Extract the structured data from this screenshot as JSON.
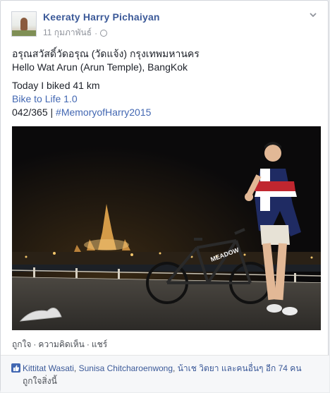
{
  "post": {
    "author": "Keeraty Harry Pichaiyan",
    "date": "11 กุมภาพันธ์",
    "meta_separator": "·",
    "body": {
      "line1": "อรุณสวัสดิ์วัดอรุณ (วัดแจ้ง) กรุงเทพมหานคร",
      "line2": "Hello Wat Arun (Arun Temple), BangKok",
      "line3": "Today I biked 41 km",
      "line4_link": "Bike to Life 1.0",
      "line5_prefix": "042/365 | ",
      "line5_hashtag": "#MemoryofHarry2015"
    },
    "photo": {
      "bike_brand_text": "MEADOW"
    }
  },
  "actions": {
    "like": "ถูกใจ",
    "comment": "ความคิดเห็น",
    "share": "แชร์",
    "separator": "·"
  },
  "likes_bar": {
    "name1": "Kittitat Wasati",
    "name2": "Sunisa Chitcharoenwong",
    "name3": "น้าเช วิตยา",
    "others_text": "และคนอื่นๆ อีก 74 คน",
    "line2": "ถูกใจสิ่งนี้"
  },
  "colors": {
    "link": "#4267b2",
    "author": "#3b5998",
    "background": "#e9ebee"
  },
  "icons": {
    "audience": "globe-icon",
    "options": "chevron-down-icon",
    "likes": "thumbs-up-icon"
  }
}
